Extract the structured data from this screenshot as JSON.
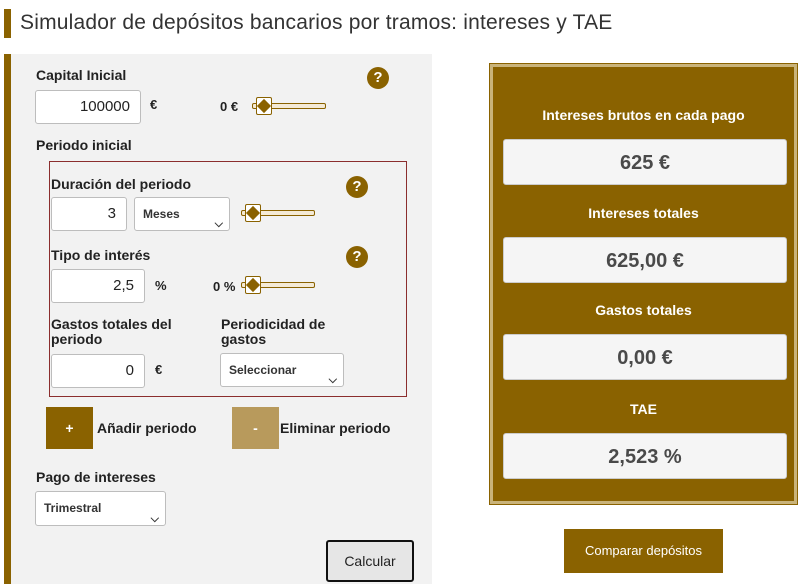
{
  "page": {
    "title": "Simulador de depósitos bancarios por tramos: intereses y TAE"
  },
  "form": {
    "capital": {
      "label": "Capital Inicial",
      "value": "100000",
      "unit": "€",
      "slider_value": "0 €",
      "slider_fraction": 0.0,
      "help": "?"
    },
    "period_title": "Periodo inicial",
    "period": {
      "duration": {
        "label": "Duración del periodo",
        "value": "3",
        "unit_selected": "Meses",
        "slider_fraction": 0.0,
        "help": "?"
      },
      "rate": {
        "label": "Tipo de interés",
        "value": "2,5",
        "unit": "%",
        "slider_value": "0 %",
        "slider_fraction": 0.0,
        "help": "?"
      },
      "costs": {
        "label_line1": "Gastos totales del",
        "label_line2": "periodo",
        "value": "0",
        "unit": "€"
      },
      "cost_frequency": {
        "label_line1": "Periodicidad de",
        "label_line2": "gastos",
        "selected": "Seleccionar"
      }
    },
    "add_period": {
      "symbol": "+",
      "label": "Añadir periodo"
    },
    "remove_period": {
      "symbol": "-",
      "label": "Eliminar periodo"
    },
    "interest_payment": {
      "label": "Pago de intereses",
      "selected": "Trimestral"
    },
    "calculate_label": "Calcular"
  },
  "results": {
    "gross_interest_label": "Intereses brutos en cada pago",
    "gross_interest_value": "625 €",
    "total_interest_label": "Intereses totales",
    "total_interest_value": "625,00 €",
    "total_costs_label": "Gastos totales",
    "total_costs_value": "0,00 €",
    "tae_label": "TAE",
    "tae_value": "2,523 %"
  },
  "compare_label": "Comparar depósitos",
  "colors": {
    "accent": "#8a6200",
    "accent_light": "#b89a5c",
    "period_border": "#8b2e2e"
  },
  "icons": {
    "help": "question-circle-icon",
    "slider_thumb": "slider-thumb-icon",
    "dropdown": "chevron-down-icon"
  }
}
